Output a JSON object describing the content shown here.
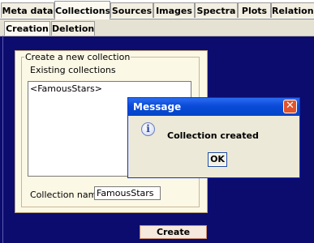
{
  "top_tabs": [
    "Meta data",
    "Collections",
    "Sources",
    "Images",
    "Spectra",
    "Plots",
    "Relations"
  ],
  "active_top_tab": "Collections",
  "sub_tabs": [
    "Creation",
    "Deletion"
  ],
  "active_sub_tab": "Creation",
  "form": {
    "group_title": "Create a new collection",
    "existing_label": "Existing collections",
    "existing_items": [
      "<FamousStars>"
    ],
    "name_label": "Collection name",
    "name_value": "FamousStars",
    "create_label": "Create"
  },
  "dialog": {
    "title": "Message",
    "message": "Collection created",
    "ok_label": "OK",
    "close_glyph": "✕",
    "icon": "info-icon"
  }
}
